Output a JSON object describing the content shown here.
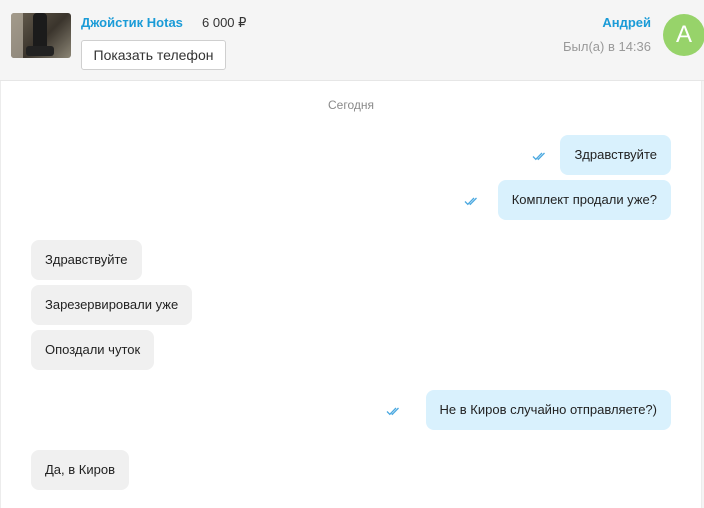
{
  "header": {
    "item_title": "Джойстик Hotas",
    "item_price": "6 000 ₽",
    "show_phone_label": "Показать телефон",
    "user_name": "Андрей",
    "last_seen": "Был(а) в 14:36",
    "avatar_letter": "А",
    "avatar_color": "#97d36a",
    "link_color": "#1a9bd7"
  },
  "chat": {
    "date_label": "Сегодня",
    "messages": [
      {
        "direction": "out",
        "text": "Здравствуйте",
        "status": "read"
      },
      {
        "direction": "out",
        "text": "Комплект продали уже?",
        "status": "read"
      },
      {
        "direction": "in",
        "text": "Здравствуйте"
      },
      {
        "direction": "in",
        "text": "Зарезервировали уже"
      },
      {
        "direction": "in",
        "text": "Опоздали чуток"
      },
      {
        "direction": "out",
        "text": "Не в Киров случайно отправляете?)",
        "status": "read"
      },
      {
        "direction": "in",
        "text": "Да, в Киров"
      }
    ]
  }
}
